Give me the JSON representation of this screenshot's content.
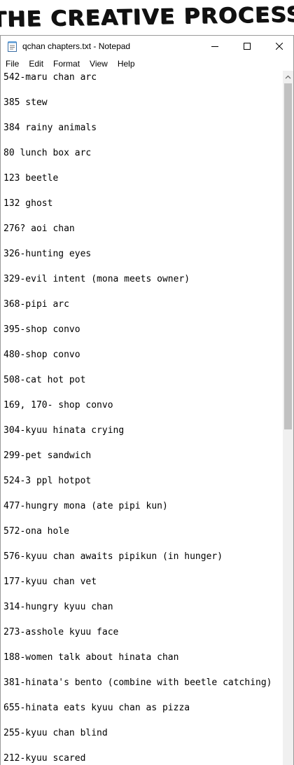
{
  "banner": {
    "title": "THE CREATIVE PROCESS"
  },
  "window": {
    "title": "qchan chapters.txt - Notepad",
    "icons": {
      "app": "notepad-icon",
      "minimize": "minimize-icon",
      "maximize": "maximize-icon",
      "close": "close-icon",
      "scroll_up": "chevron-up-icon"
    }
  },
  "menu": {
    "items": [
      {
        "label": "File"
      },
      {
        "label": "Edit"
      },
      {
        "label": "Format"
      },
      {
        "label": "View"
      },
      {
        "label": "Help"
      }
    ]
  },
  "document": {
    "lines": [
      "542-maru chan arc",
      "385 stew",
      "384 rainy animals",
      "80 lunch box arc",
      "123 beetle",
      "132 ghost",
      "276? aoi chan",
      "326-hunting eyes",
      "329-evil intent (mona meets owner)",
      "368-pipi arc",
      "395-shop convo",
      "480-shop convo",
      "508-cat hot pot",
      "169, 170- shop convo",
      "304-kyuu hinata crying",
      "299-pet sandwich",
      "524-3 ppl hotpot",
      "477-hungry mona (ate pipi kun)",
      "572-ona hole",
      "576-kyuu chan awaits pipikun (in hunger)",
      "177-kyuu chan vet",
      "314-hungry kyuu chan",
      "273-asshole kyuu face",
      "188-women talk about hinata chan",
      "381-hinata's bento (combine with beetle catching)",
      "655-hinata eats kyuu chan as pizza",
      "255-kyuu chan blind",
      "212-kyuu scared"
    ]
  },
  "colors": {
    "scroll_track": "#f0f0f0",
    "scroll_thumb": "#c1c1c1",
    "window_border": "#9a9a9a",
    "text": "#000000"
  }
}
